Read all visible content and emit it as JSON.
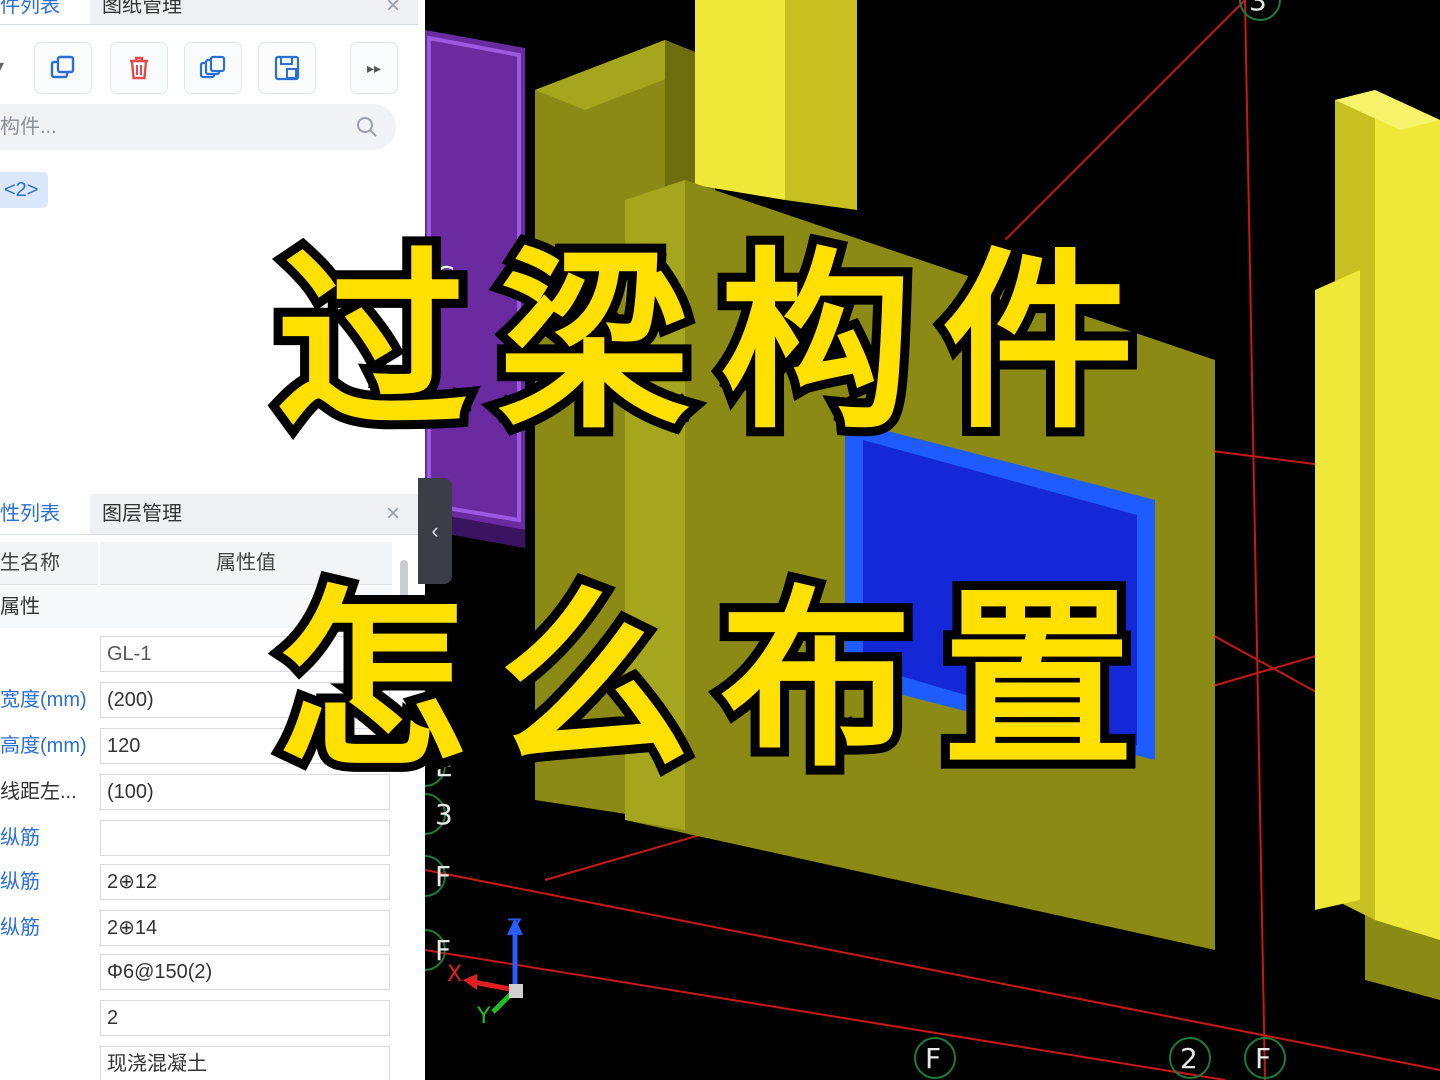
{
  "left_panel": {
    "top_tabs": {
      "tab1": "件列表",
      "tab2": "图纸管理",
      "close": "×"
    },
    "toolbar": {
      "buttons": [
        "copy-icon",
        "delete-icon",
        "duplicate-icon",
        "save-icon",
        "more-icon"
      ],
      "more_label": "▸▸"
    },
    "search": {
      "placeholder": "构件..."
    },
    "tree_chip": "<2>",
    "bottom_tabs": {
      "tab1": "性列表",
      "tab2": "图层管理",
      "close": "×"
    },
    "table": {
      "col_name": "生名称",
      "col_value": "属性值",
      "group": "属性",
      "rows": [
        {
          "label": "",
          "value": "GL-1"
        },
        {
          "label": "宽度(mm)",
          "value": "(200)"
        },
        {
          "label": "高度(mm)",
          "value": "120"
        },
        {
          "label": "线距左...",
          "value": "(100)"
        },
        {
          "label": "纵筋",
          "value": ""
        },
        {
          "label": "纵筋",
          "value": "2⊕12"
        },
        {
          "label": "纵筋",
          "value": "2⊕14"
        },
        {
          "label": "",
          "value": "Φ6@150(2)"
        },
        {
          "label": "",
          "value": "2"
        },
        {
          "label": "",
          "value": "现浇混凝土"
        }
      ]
    },
    "collapse_label": "‹"
  },
  "viewport": {
    "grid_labels": [
      "3",
      "C",
      "E",
      "3",
      "F",
      "F",
      "F",
      "2",
      "F"
    ],
    "axes": {
      "x": "X",
      "y": "Y",
      "z": "Z"
    },
    "colors": {
      "wall": "#8a8a14",
      "column": "#f0e838",
      "window": "#1428d8",
      "frame": "#1e5cff",
      "panel": "#6a2aa0",
      "grid": "#c81818"
    }
  },
  "overlay": {
    "line1": "过梁构件",
    "line2": "怎么布置",
    "color": "#ffe000"
  }
}
